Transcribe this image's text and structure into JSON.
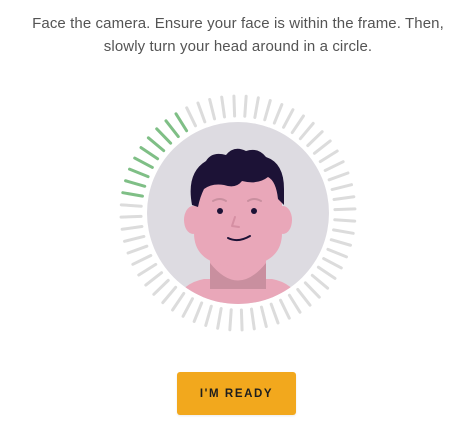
{
  "instruction": {
    "line1": "Face the camera. Ensure your face is within the frame. Then,",
    "line2": "slowly turn your head around in a circle."
  },
  "scanner": {
    "progress": 0.15,
    "tick_count": 60,
    "colors": {
      "progress_tick": "#7fbf86",
      "idle_tick": "#dcdcdc",
      "face_background": "#dddbe1",
      "skin": "#e9a7b9",
      "hair": "#1c1236"
    },
    "avatar_icon": "face-avatar-icon"
  },
  "ready_button": {
    "label": "I'M READY",
    "color": "#f2a81d"
  }
}
